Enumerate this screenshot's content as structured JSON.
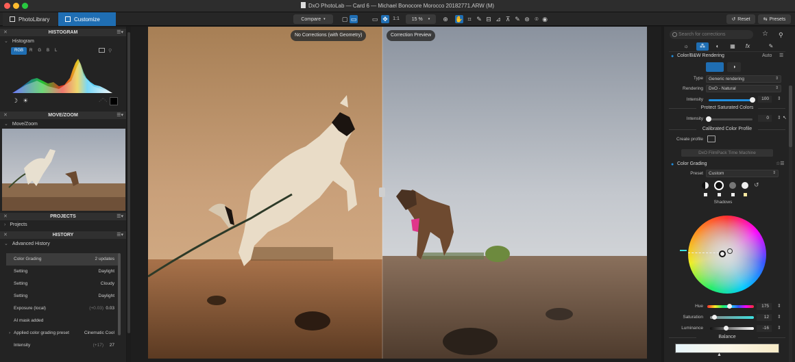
{
  "window": {
    "title": "DxO PhotoLab — Card 6 — Michael Bonocore Morocco 20182771.ARW (M)"
  },
  "tabs": {
    "photolibrary": "PhotoLibrary",
    "customize": "Customize"
  },
  "toolbar": {
    "compare": "Compare",
    "one_to_one": "1:1",
    "zoom": "15 %",
    "reset": "Reset",
    "presets": "Presets"
  },
  "histogram": {
    "header": "HISTOGRAM",
    "sub": "Histogram",
    "channels": [
      "RGB",
      "R",
      "G",
      "B",
      "L"
    ],
    "selected_channel": "RGB"
  },
  "movezoom": {
    "header": "MOVE/ZOOM",
    "sub": "Move/Zoom"
  },
  "projects": {
    "header": "PROJECTS",
    "sub": "Projects"
  },
  "history": {
    "header": "HISTORY",
    "sub": "Advanced History",
    "rows": [
      {
        "label": "Color Grading",
        "old": "",
        "value": "2 updates",
        "selected": true,
        "chevron": false
      },
      {
        "label": "Setting",
        "old": "",
        "value": "Daylight",
        "selected": false,
        "chevron": false
      },
      {
        "label": "Setting",
        "old": "",
        "value": "Cloudy",
        "selected": false,
        "chevron": false
      },
      {
        "label": "Setting",
        "old": "",
        "value": "Daylight",
        "selected": false,
        "chevron": false
      },
      {
        "label": "Exposure (local)",
        "old": "(+0.03)",
        "value": "0.03",
        "selected": false,
        "chevron": false
      },
      {
        "label": "AI mask added",
        "old": "",
        "value": "",
        "selected": false,
        "chevron": false
      },
      {
        "label": "Applied color grading preset",
        "old": "",
        "value": "Cinematic Cool",
        "selected": false,
        "chevron": true
      },
      {
        "label": "Intensity",
        "old": "(+17)",
        "value": "27",
        "selected": false,
        "chevron": false
      }
    ]
  },
  "viewer": {
    "left_badge": "No Corrections (with Geometry)",
    "right_badge": "Correction Preview"
  },
  "right": {
    "search_placeholder": "Search for corrections",
    "color_bw": {
      "title": "Color/B&W Rendering",
      "auto": "Auto",
      "type_label": "Type",
      "type_value": "Generic rendering",
      "rendering_label": "Rendering",
      "rendering_value": "DxO - Natural",
      "intensity_label": "Intensity",
      "intensity_value": "100",
      "intensity_level": 100,
      "protect_title": "Protect Saturated Colors",
      "protect_intensity_label": "Intensity",
      "protect_intensity_value": "0",
      "protect_intensity_level": 0,
      "calibrated_title": "Calibrated Color Profile",
      "create_profile": "Create profile",
      "filmpack_button": "DxO FilmPack Time Machine"
    },
    "color_grading": {
      "title": "Color Grading",
      "preset_label": "Preset",
      "preset_value": "Custom",
      "wheel_label": "Shadows",
      "hue_label": "Hue",
      "hue_value": "175",
      "saturation_label": "Saturation",
      "saturation_value": "12",
      "luminance_label": "Luminance",
      "luminance_value": "-16",
      "balance_label": "Balance"
    }
  },
  "colors": {
    "accent": "#1f6eb3",
    "panel": "#232323",
    "header": "#303030"
  }
}
